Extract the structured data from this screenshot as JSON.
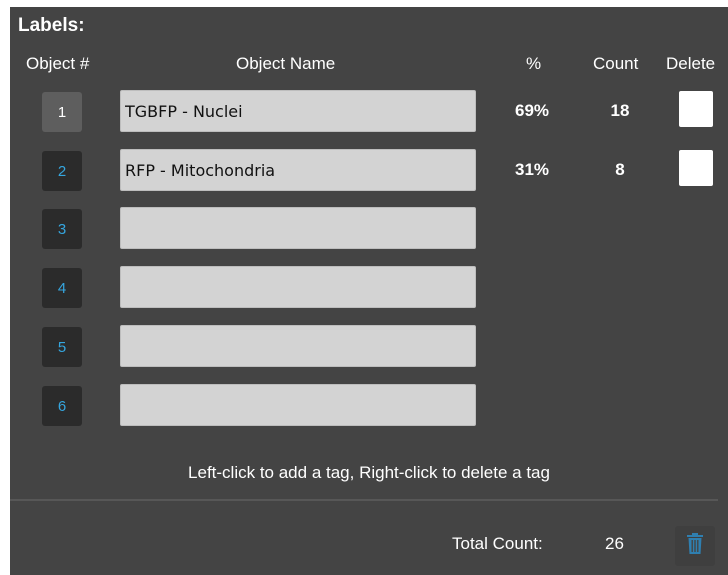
{
  "labels_title": "Labels:",
  "headers": {
    "object_num": "Object #",
    "object_name": "Object Name",
    "percent": "%",
    "count": "Count",
    "delete": "Delete"
  },
  "rows": [
    {
      "num": "1",
      "name": "TGBFP - Nuclei",
      "percent": "69%",
      "count": "18",
      "active": true,
      "has_delete": true
    },
    {
      "num": "2",
      "name": "RFP - Mitochondria",
      "percent": "31%",
      "count": "8",
      "active": false,
      "has_delete": true
    },
    {
      "num": "3",
      "name": "",
      "percent": "",
      "count": "",
      "active": false,
      "has_delete": false
    },
    {
      "num": "4",
      "name": "",
      "percent": "",
      "count": "",
      "active": false,
      "has_delete": false
    },
    {
      "num": "5",
      "name": "",
      "percent": "",
      "count": "",
      "active": false,
      "has_delete": false
    },
    {
      "num": "6",
      "name": "",
      "percent": "",
      "count": "",
      "active": false,
      "has_delete": false
    }
  ],
  "hint": "Left-click to add a tag, Right-click to delete a tag",
  "total": {
    "label": "Total Count:",
    "value": "26"
  },
  "colors": {
    "panel_bg": "#444444",
    "accent": "#35a6df",
    "button_bg": "#2b2b2b",
    "button_active_bg": "#5e5e5e",
    "input_bg": "#d3d3d3"
  },
  "icons": {
    "trash": "trash-icon"
  }
}
